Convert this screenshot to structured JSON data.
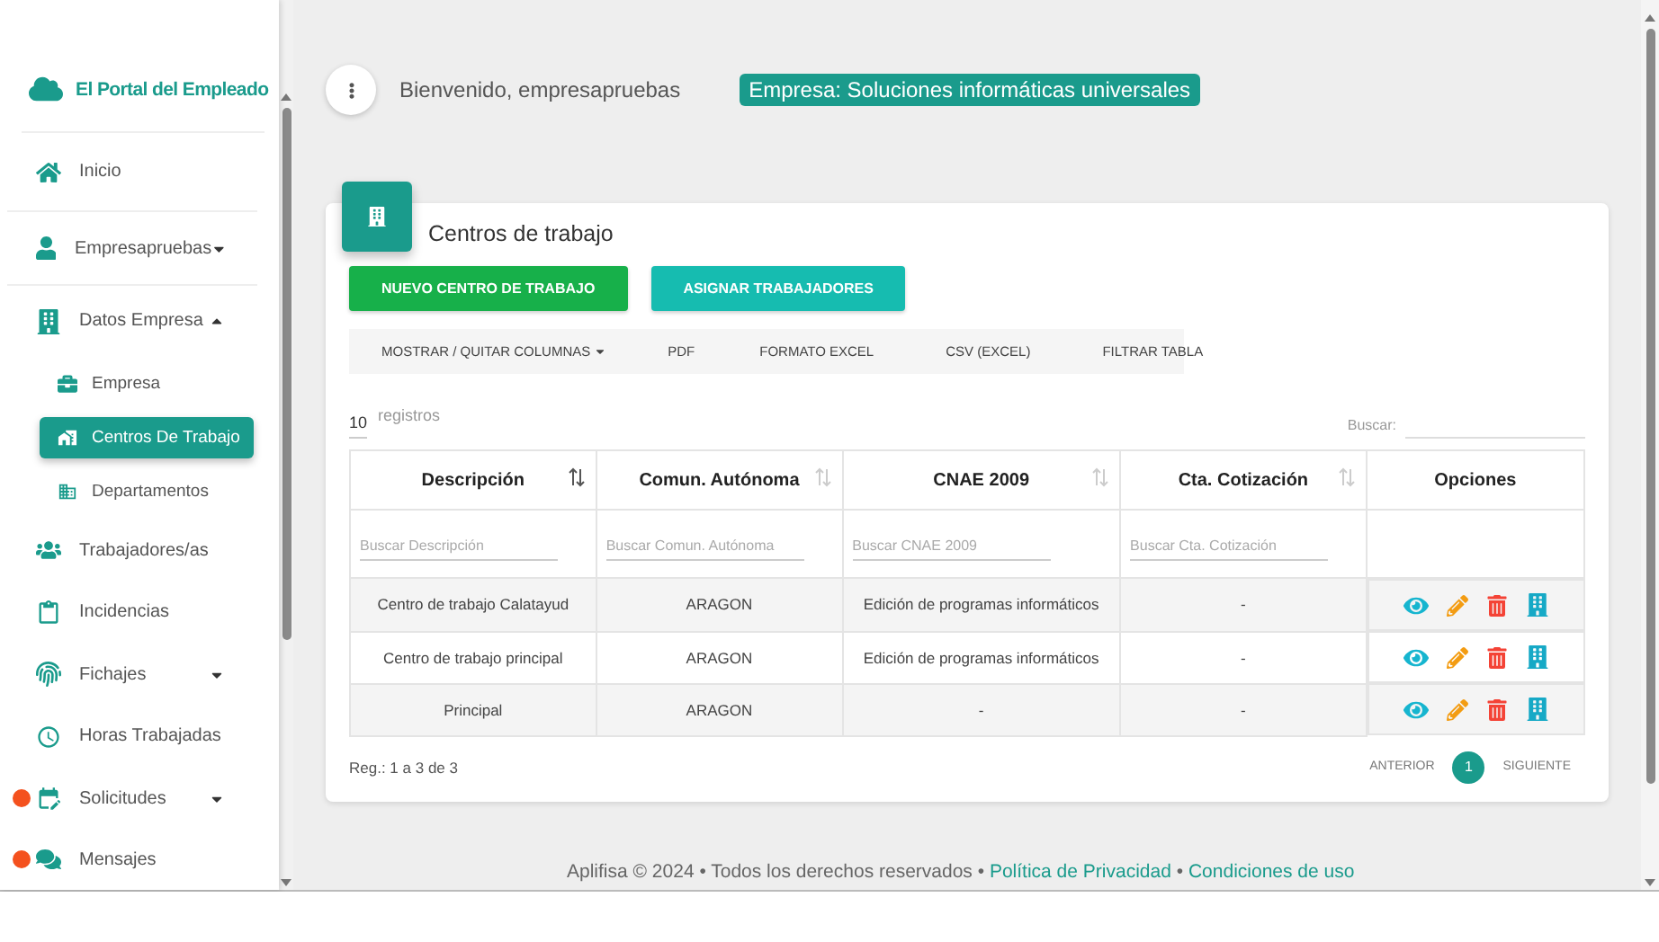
{
  "sidebar": {
    "brand": "El Portal del Empleado",
    "items": [
      {
        "label": "Inicio",
        "selected": false,
        "alert": false
      },
      {
        "label": "Empresapruebas",
        "selected": false,
        "expanded": false,
        "alert": false
      },
      {
        "label": "Datos Empresa",
        "selected": false,
        "expanded": true,
        "alert": false,
        "children": [
          {
            "label": "Empresa",
            "selected": false
          },
          {
            "label": "Centros De Trabajo",
            "selected": true
          },
          {
            "label": "Departamentos",
            "selected": false
          }
        ]
      },
      {
        "label": "Trabajadores/as",
        "selected": false,
        "alert": false
      },
      {
        "label": "Incidencias",
        "selected": false,
        "alert": false
      },
      {
        "label": "Fichajes",
        "selected": false,
        "expanded": false,
        "alert": false
      },
      {
        "label": "Horas Trabajadas",
        "selected": false,
        "alert": false
      },
      {
        "label": "Solicitudes",
        "selected": false,
        "expanded": false,
        "alert": true
      },
      {
        "label": "Mensajes",
        "selected": false,
        "alert": true
      }
    ]
  },
  "header": {
    "welcome": "Bienvenido, empresapruebas",
    "company": "Empresa: Soluciones informáticas universales"
  },
  "card": {
    "title": "Centros de trabajo",
    "actions": [
      {
        "label": "NUEVO CENTRO DE TRABAJO",
        "color": "#17b04a"
      },
      {
        "label": "ASIGNAR TRABAJADORES",
        "color": "#16bcb0"
      }
    ],
    "toolbar": [
      {
        "label": "MOSTRAR / QUITAR COLUMNAS",
        "dropdown": true
      },
      {
        "label": "PDF",
        "dropdown": false
      },
      {
        "label": "FORMATO EXCEL",
        "dropdown": false
      },
      {
        "label": "CSV (EXCEL)",
        "dropdown": false
      },
      {
        "label": "FILTRAR TABLA",
        "dropdown": false
      }
    ],
    "page_size": "10",
    "page_size_label": "registros",
    "search_label": "Buscar:",
    "columns": [
      {
        "label": "Descripción",
        "sorted": true,
        "placeholder": "Buscar Descripción"
      },
      {
        "label": "Comun. Autónoma",
        "sorted": false,
        "placeholder": "Buscar Comun. Autónoma"
      },
      {
        "label": "CNAE 2009",
        "sorted": false,
        "placeholder": "Buscar CNAE 2009"
      },
      {
        "label": "Cta. Cotización",
        "sorted": false,
        "placeholder": "Buscar Cta. Cotización"
      },
      {
        "label": "Opciones"
      }
    ],
    "rows": [
      [
        "Centro de trabajo Calatayud",
        "ARAGON",
        "Edición de programas informáticos",
        "-"
      ],
      [
        "Centro de trabajo principal",
        "ARAGON",
        "Edición de programas informáticos",
        "-"
      ],
      [
        "Principal",
        "ARAGON",
        "-",
        "-"
      ]
    ],
    "summary": "Reg.: 1 a 3 de 3",
    "pagination": {
      "previous": "ANTERIOR",
      "pages": [
        {
          "label": "1",
          "selected": true
        }
      ],
      "next": "SIGUIENTE"
    }
  },
  "footer": {
    "text": "Aplifisa © 2024 • Todos los derechos reservados •",
    "links": [
      "Política de Privacidad",
      "Condiciones de uso"
    ],
    "separator": "•"
  }
}
